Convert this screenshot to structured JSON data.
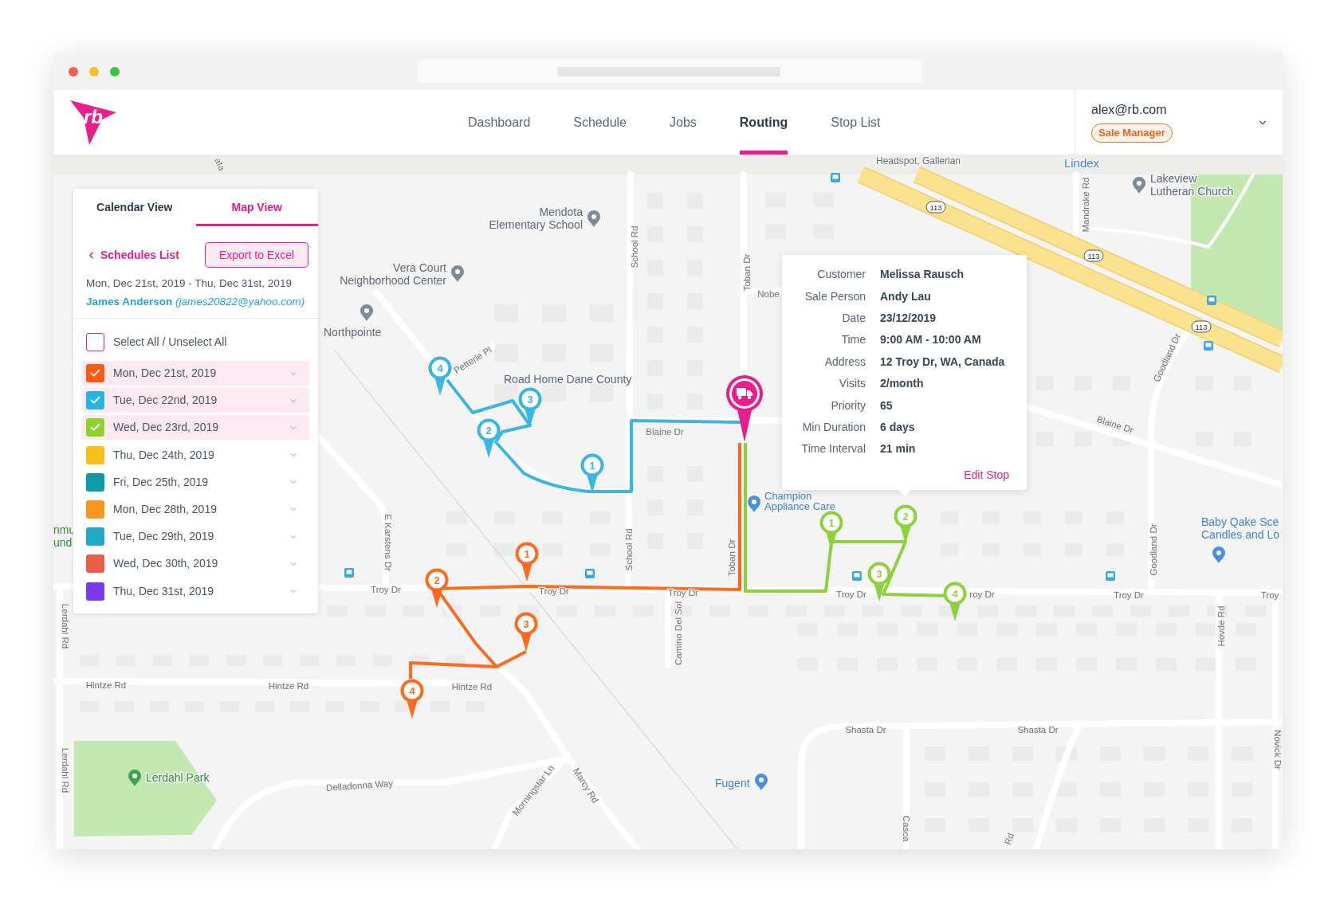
{
  "app": {
    "logo": "rb",
    "nav": [
      {
        "label": "Dashboard",
        "selected": false
      },
      {
        "label": "Schedule",
        "selected": false
      },
      {
        "label": "Jobs",
        "selected": false
      },
      {
        "label": "Routing",
        "selected": true
      },
      {
        "label": "Stop List",
        "selected": false
      }
    ],
    "user": {
      "email": "alex@rb.com",
      "role": "Sale Manager"
    }
  },
  "schedule": {
    "tabs": [
      {
        "label": "Calendar View",
        "selected": false
      },
      {
        "label": "Map View",
        "selected": true
      }
    ],
    "back_link": "Schedules List",
    "export_button": "Export to Excel",
    "date_range": "Mon, Dec 21st, 2019 - Thu, Dec 31st, 2019",
    "customer": "**James Anderson** *(james20822@yahoo.com)*",
    "select_all": {
      "label": "Select All / Unselect All",
      "checked": false
    },
    "days": [
      {
        "label": "Mon, Dec 21st, 2019",
        "color": "#fe5b12",
        "checked": true
      },
      {
        "label": "Tue, Dec 22nd, 2019",
        "color": "#27b4e3",
        "checked": true
      },
      {
        "label": "Wed, Dec 23rd, 2019",
        "color": "#8fd12d",
        "checked": true
      },
      {
        "label": "Thu, Dec 24th, 2019",
        "color": "#f8c01a",
        "checked": false
      },
      {
        "label": "Fri, Dec 25th, 2019",
        "color": "#0f9aa8",
        "checked": false
      },
      {
        "label": "Mon, Dec 28th, 2019",
        "color": "#f6961e",
        "checked": false
      },
      {
        "label": "Tue, Dec 29th, 2019",
        "color": "#21aac6",
        "checked": false
      },
      {
        "label": "Wed, Dec 30th, 2019",
        "color": "#e95f45",
        "checked": false
      },
      {
        "label": "Thu, Dec 31st, 2019",
        "color": "#7a3aeb",
        "checked": false
      }
    ]
  },
  "popup": {
    "fields": [
      {
        "label": "Customer",
        "value": "Melissa Rausch"
      },
      {
        "label": "Sale Person",
        "value": "Andy Lau"
      },
      {
        "label": "Date",
        "value": "23/12/2019"
      },
      {
        "label": "Time",
        "value": "9:00 AM - 10:00 AM"
      },
      {
        "label": "Address",
        "value": "12 Troy Dr, WA, Canada"
      },
      {
        "label": "Visits",
        "value": "2/month"
      },
      {
        "label": "Priority",
        "value": "65"
      },
      {
        "label": "Min Duration",
        "value": "6 days"
      },
      {
        "label": "Time Interval",
        "value": "21 min"
      }
    ],
    "link": "Edit Stop"
  },
  "map": {
    "places": [
      {
        "kind": "locality",
        "lines": [
          "Headspot, Gallerian"
        ]
      },
      {
        "kind": "store",
        "lines": [
          "Lindex"
        ]
      },
      {
        "kind": "landmark",
        "lines": [
          "Lakeview",
          "Lutheran Church"
        ]
      },
      {
        "kind": "landmark",
        "lines": [
          "Mendota",
          "Elementary School"
        ]
      },
      {
        "kind": "landmark",
        "lines": [
          "Vera Court",
          "Neighborhood Center"
        ]
      },
      {
        "kind": "landmark",
        "lines": [
          "Northpointe"
        ]
      },
      {
        "kind": "landmark",
        "lines": [
          "Road Home Dane County"
        ]
      },
      {
        "kind": "store",
        "lines": [
          "Champion",
          "Appliance Care"
        ]
      },
      {
        "kind": "store",
        "lines": [
          "Baby Qake Sce",
          "Candles and Lo"
        ]
      },
      {
        "kind": "park",
        "lines": [
          "Lerdahl Park"
        ]
      },
      {
        "kind": "store",
        "lines": [
          "Fugent"
        ]
      },
      {
        "kind": "park",
        "lines": [
          "nmu",
          "und"
        ]
      }
    ],
    "streets": [
      "Troy Dr",
      "Troy Dr",
      "Troy Dr",
      "Troy Dr",
      "roy Dr",
      "Troy Dr",
      "Troy",
      "Hintze Rd",
      "Hintze Rd",
      "Hintze Rd",
      "Delladonna Way",
      "Morningstar Ln",
      "Marcy Rd",
      "Shasta Dr",
      "Shasta Dr",
      "School Rd",
      "School Rd",
      "Toban Dr",
      "Toban Dr",
      "Nobe",
      "Blaine Dr",
      "Blaine Dr",
      "Petterle Pl",
      "E Karstens Dr",
      "Lerdahl Rd",
      "Lerdahl Rd",
      "Camino Del Sol",
      "Goodland Dr",
      "Goodland Dr",
      "Mandrake Rd",
      "Hovde Rd",
      "Novick Dr",
      "Casca",
      "Rd",
      "ata"
    ],
    "shields": [
      "113",
      "113",
      "113"
    ],
    "routes": [
      {
        "color": "#ff6a1c",
        "stops": [
          "1",
          "2",
          "3",
          "4"
        ]
      },
      {
        "color": "#3bb5e4",
        "stops": [
          "1",
          "2",
          "3",
          "4"
        ]
      },
      {
        "color": "#8ed13d",
        "stops": [
          "1",
          "2",
          "3",
          "4"
        ]
      }
    ]
  }
}
